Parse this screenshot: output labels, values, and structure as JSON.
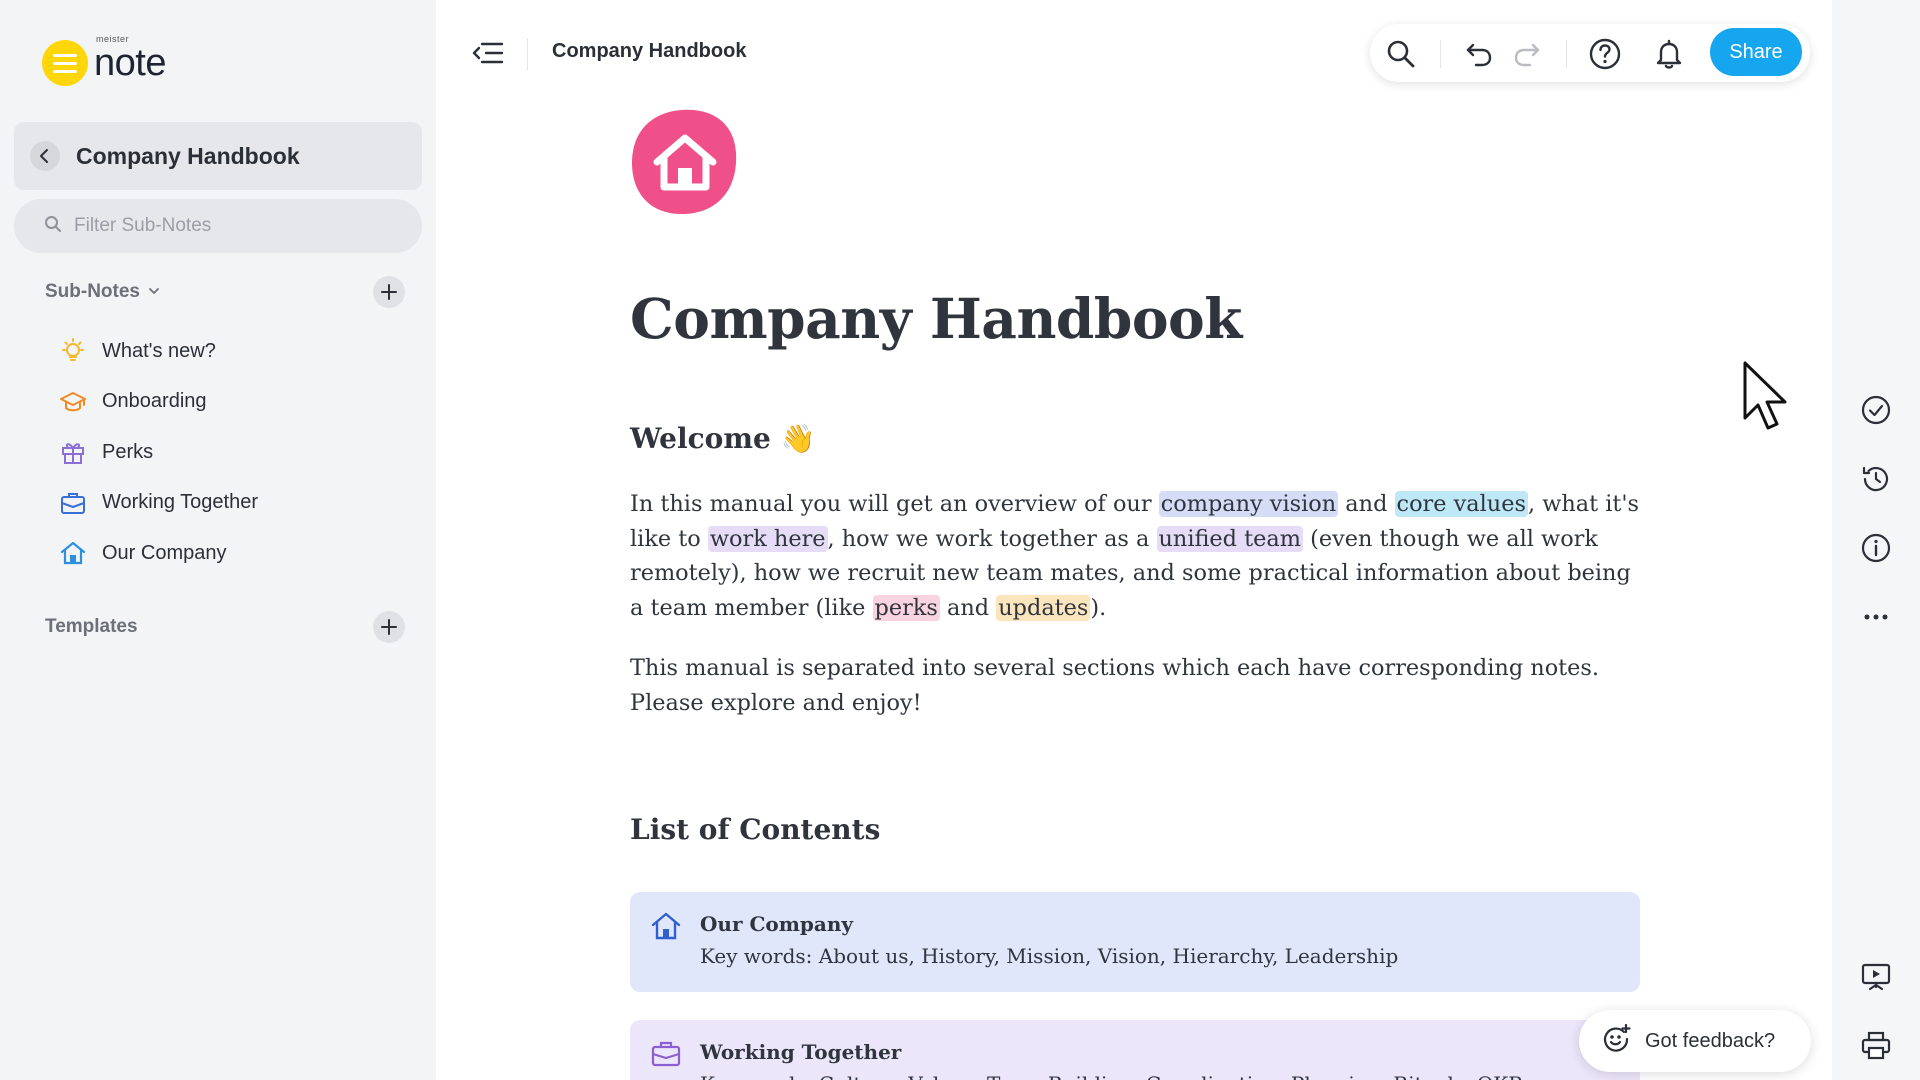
{
  "app": {
    "logo_small": "meister",
    "logo_main": "note"
  },
  "sidebar": {
    "parent_title": "Company Handbook",
    "filter_placeholder": "Filter Sub-Notes",
    "subnotes_heading": "Sub-Notes",
    "subnotes": [
      {
        "label": "What's new?",
        "icon": "lightbulb-icon",
        "color": "#f5b82e"
      },
      {
        "label": "Onboarding",
        "icon": "graduation-cap-icon",
        "color": "#f08a24"
      },
      {
        "label": "Perks",
        "icon": "gift-icon",
        "color": "#8b6fd6"
      },
      {
        "label": "Working Together",
        "icon": "briefcase-icon",
        "color": "#3b6fd8"
      },
      {
        "label": "Our Company",
        "icon": "house-icon",
        "color": "#2d8fe0"
      }
    ],
    "templates_heading": "Templates"
  },
  "topbar": {
    "title": "Company Handbook",
    "share_label": "Share"
  },
  "document": {
    "title": "Company Handbook",
    "welcome_heading": "Welcome 👋",
    "intro": {
      "p1": "In this manual you will get an overview of our ",
      "h1": "company vision",
      "p2": " and ",
      "h2": "core values",
      "p3": ", what it's like to ",
      "h3": "work here",
      "p4": ", how we work together as a ",
      "h4": "unified team",
      "p5": " (even though we all work remotely), how we recruit new team mates, and some practical information about being a team member (like ",
      "h5": "perks",
      "p6": " and ",
      "h6": "updates",
      "p7": ")."
    },
    "second_paragraph": "This manual is separated into several sections which each have corresponding notes. Please explore and enjoy!",
    "contents_heading": "List of Contents",
    "contents": [
      {
        "title": "Our Company",
        "keys": "Key words: About us, History, Mission, Vision, Hierarchy, Leadership",
        "bg": "#e1e7fb",
        "icon": "house-icon"
      },
      {
        "title": "Working Together",
        "keys": "Key words: Culture, Values, Team Building, Coordination, Planning, Rituals, OKRs",
        "bg": "#ece6fa",
        "icon": "briefcase-icon"
      }
    ]
  },
  "feedback": {
    "label": "Got feedback?"
  },
  "colors": {
    "accent": "#16a6ef",
    "doc_icon": "#f0508a",
    "logo": "#ffd60a"
  }
}
